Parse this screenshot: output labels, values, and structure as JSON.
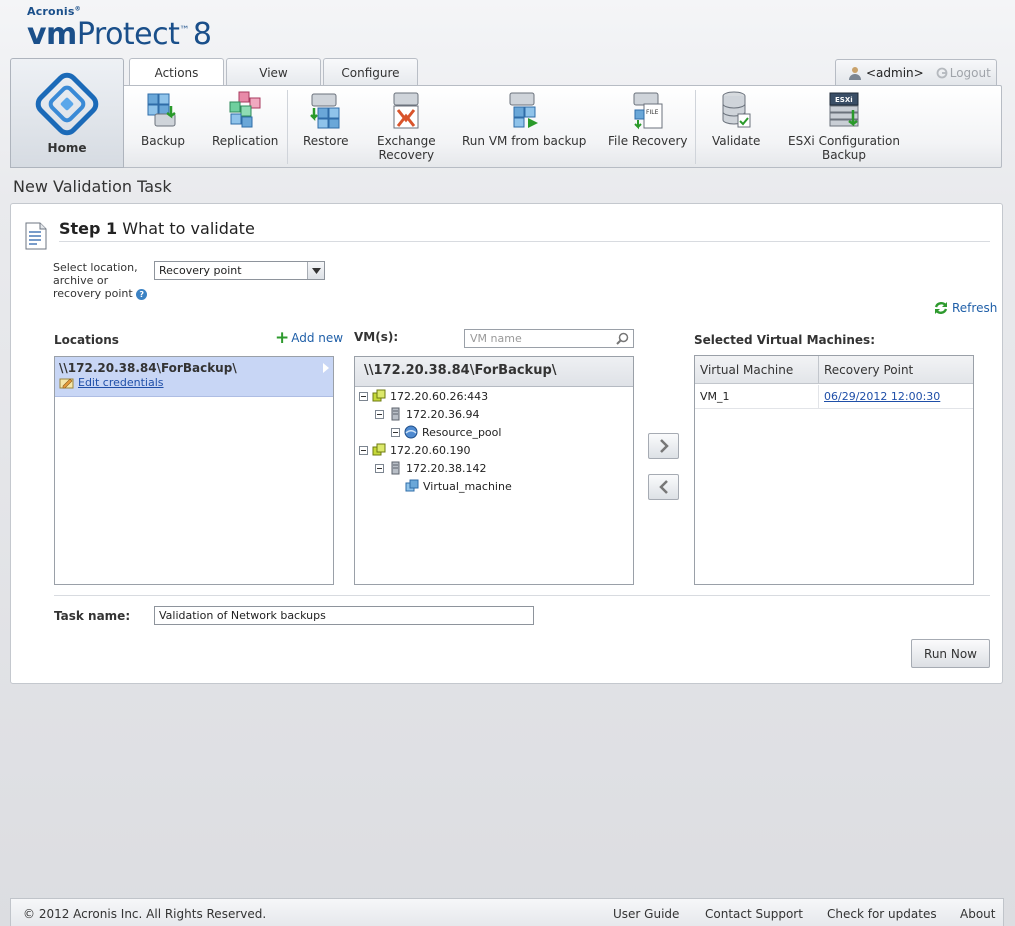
{
  "brand": {
    "company": "Acronis",
    "product_prefix": "vm",
    "product_name": "Protect",
    "version": "8"
  },
  "user": {
    "name": "<admin>",
    "logout": "Logout"
  },
  "tabs": [
    {
      "label": "Actions",
      "active": true
    },
    {
      "label": "View",
      "active": false
    },
    {
      "label": "Configure",
      "active": false
    }
  ],
  "home": {
    "label": "Home"
  },
  "ribbon": {
    "backup": "Backup",
    "replication": "Replication",
    "restore": "Restore",
    "exchange_line1": "Exchange",
    "exchange_line2": "Recovery",
    "run_vm": "Run VM from backup",
    "file_recovery": "File Recovery",
    "validate": "Validate",
    "esxi_line1": "ESXi Configuration",
    "esxi_line2": "Backup",
    "esxi_badge": "ESXi",
    "file_badge": "FILE"
  },
  "page": {
    "title": "New Validation Task"
  },
  "step": {
    "number_label": "Step 1",
    "title": "What to validate"
  },
  "select_location": {
    "label": "Select location, archive or recovery point",
    "value": "Recovery point",
    "help": "?"
  },
  "refresh": "Refresh",
  "locations": {
    "header": "Locations",
    "add_new": "Add new",
    "items": [
      {
        "path": "\\\\172.20.38.84\\ForBackup\\",
        "edit": "Edit credentials"
      }
    ]
  },
  "vms": {
    "header": "VM(s):",
    "search_placeholder": "VM name",
    "tree_header": "\\\\172.20.38.84\\ForBackup\\",
    "tree": {
      "host1": "172.20.60.26:443",
      "host1_child": "172.20.36.94",
      "host1_pool": "Resource_pool",
      "host2": "172.20.60.190",
      "host2_child": "172.20.38.142",
      "host2_vm": "Virtual_machine"
    }
  },
  "selected": {
    "header": "Selected Virtual Machines:",
    "columns": [
      "Virtual Machine",
      "Recovery Point"
    ],
    "rows": [
      {
        "vm": "VM_1",
        "point": "06/29/2012 12:00:30"
      }
    ]
  },
  "task": {
    "label": "Task name:",
    "value": "Validation of Network backups"
  },
  "run_now": "Run Now",
  "footer": {
    "copyright": "© 2012 Acronis Inc. All Rights Reserved.",
    "links": [
      "User Guide",
      "Contact Support",
      "Check for updates",
      "About"
    ]
  }
}
